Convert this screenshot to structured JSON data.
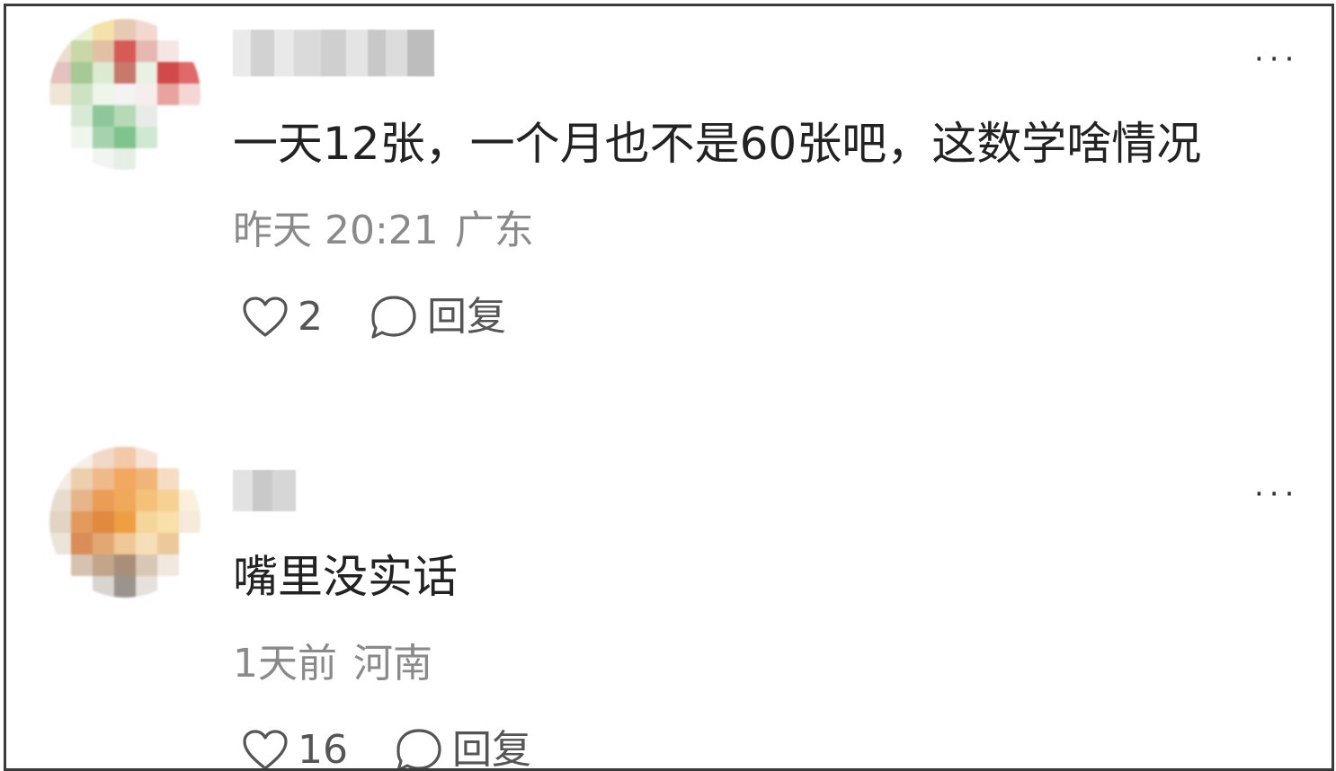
{
  "comments": [
    {
      "text": "一天12张，一个月也不是60张吧，这数学啥情况",
      "time": "昨天 20:21",
      "region": "广东",
      "likes": "2",
      "reply_label": "回复",
      "more_label": "···"
    },
    {
      "text": "嘴里没实话",
      "time": "1天前",
      "region": "河南",
      "likes": "16",
      "reply_label": "回复",
      "more_label": "···"
    }
  ],
  "colors": {
    "text": "#222222",
    "meta": "#8a8a8a",
    "action": "#555555",
    "border": "#3a3a3a"
  },
  "icons": {
    "like": "heart-outline-icon",
    "reply": "speech-bubble-icon",
    "more": "ellipsis-icon"
  }
}
